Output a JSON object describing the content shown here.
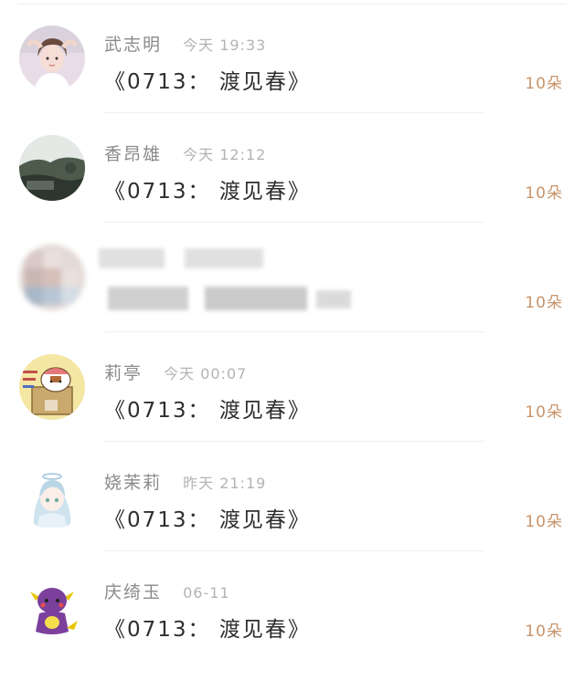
{
  "messages": [
    {
      "name": "武志明",
      "time": "今天 19:33",
      "title": "《0713： 渡见春》",
      "reward": "10朵",
      "avatar_icon": "girl-photo-avatar"
    },
    {
      "name": "香昂雄",
      "time": "今天 12:12",
      "title": "《0713： 渡见春》",
      "reward": "10朵",
      "avatar_icon": "landscape-avatar"
    },
    {
      "name": "",
      "time": "",
      "title": "",
      "reward": "10朵",
      "avatar_icon": "blurred-avatar"
    },
    {
      "name": "莉亭",
      "time": "今天 00:07",
      "title": "《0713： 渡见春》",
      "reward": "10朵",
      "avatar_icon": "cartoon-cat-box-avatar"
    },
    {
      "name": "娆茉莉",
      "time": "昨天 21:19",
      "title": "《0713： 渡见春》",
      "reward": "10朵",
      "avatar_icon": "anime-girl-avatar"
    },
    {
      "name": "庆绮玉",
      "time": "06-11",
      "title": "《0713： 渡见春》",
      "reward": "10朵",
      "avatar_icon": "purple-creature-avatar"
    }
  ],
  "colors": {
    "reward": "#c8946a",
    "name": "#8a8a8a",
    "time": "#b3b3b3",
    "title": "#2e2e2e"
  }
}
